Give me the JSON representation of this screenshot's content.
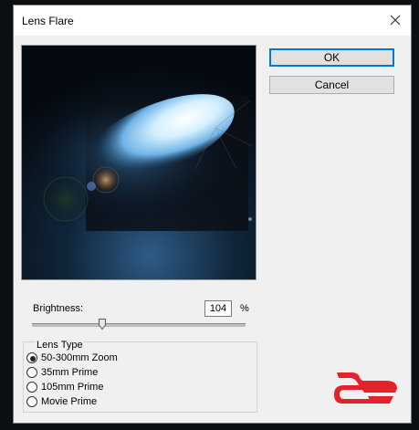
{
  "dialog": {
    "title": "Lens Flare"
  },
  "buttons": {
    "ok_label": "OK",
    "cancel_label": "Cancel"
  },
  "brightness": {
    "label": "Brightness:",
    "value": "104",
    "unit": "%",
    "slider_percent": 104
  },
  "lens_type": {
    "title": "Lens Type",
    "selected": 0,
    "options": [
      "50-300mm Zoom",
      "35mm Prime",
      "105mm Prime",
      "Movie Prime"
    ]
  },
  "colors": {
    "accent": "#0078d7",
    "logo": "#e3222b"
  }
}
